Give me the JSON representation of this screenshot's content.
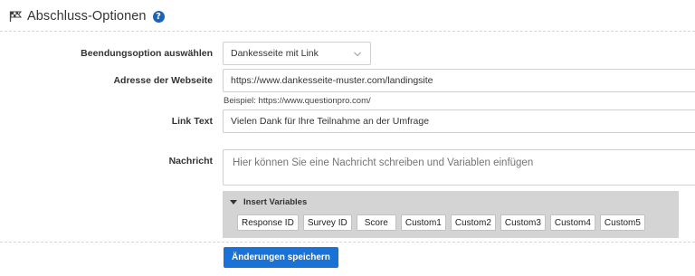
{
  "header": {
    "title": "Abschluss-Optionen",
    "help_glyph": "?"
  },
  "form": {
    "end_option": {
      "label": "Beendungsoption auswählen",
      "value": "Dankesseite mit Link"
    },
    "website": {
      "label": "Adresse der Webseite",
      "value": "https://www.dankesseite-muster.com/landingsite",
      "hint": "Beispiel: https://www.questionpro.com/"
    },
    "link_text": {
      "label": "Link Text",
      "value": "Vielen Dank für Ihre Teilnahme an der Umfrage"
    },
    "message": {
      "label": "Nachricht",
      "placeholder": "Hier können Sie eine Nachricht schreiben und Variablen einfügen"
    }
  },
  "variables": {
    "title": "Insert Variables",
    "items": [
      "Response ID",
      "Survey ID",
      "Score",
      "Custom1",
      "Custom2",
      "Custom3",
      "Custom4",
      "Custom5"
    ]
  },
  "actions": {
    "save_label": "Änderungen speichern"
  },
  "colors": {
    "accent": "#1a72d6",
    "help": "#1a63b8",
    "panel": "#d4d4d4"
  }
}
